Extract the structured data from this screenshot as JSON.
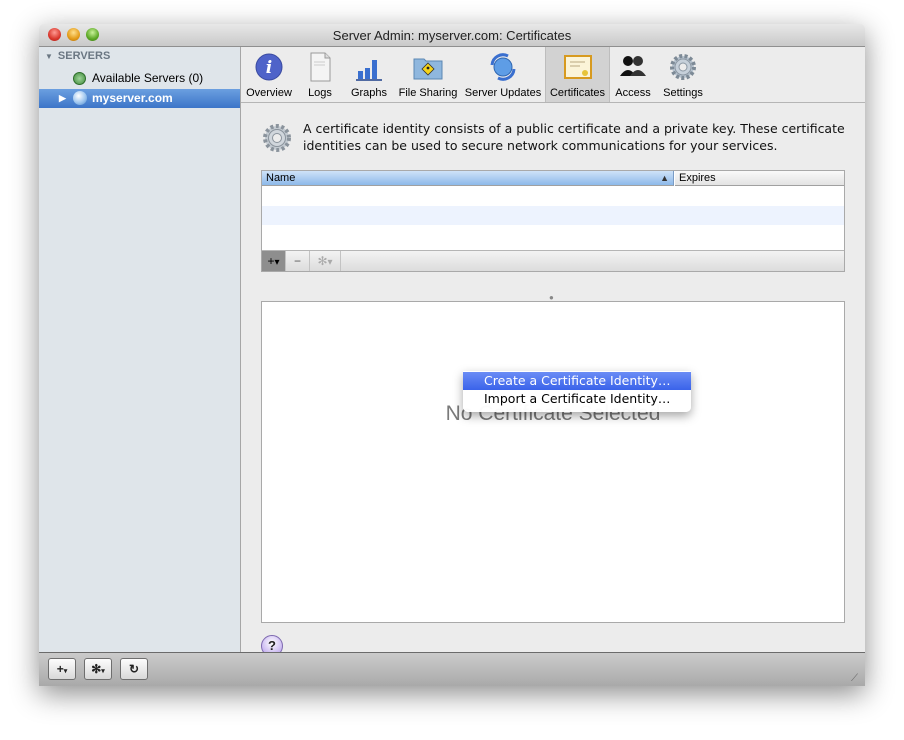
{
  "window": {
    "title": "Server Admin: myserver.com: Certificates"
  },
  "sidebar": {
    "group_label": "SERVERS",
    "items": [
      {
        "label": "Available Servers (0)",
        "icon": "network-globe-icon"
      },
      {
        "label": "myserver.com",
        "icon": "server-globe-icon",
        "selected": true
      }
    ]
  },
  "toolbar": {
    "items": [
      {
        "label": "Overview",
        "icon": "info-icon"
      },
      {
        "label": "Logs",
        "icon": "document-icon"
      },
      {
        "label": "Graphs",
        "icon": "bar-graph-icon"
      },
      {
        "label": "File Sharing",
        "icon": "shared-folder-icon"
      },
      {
        "label": "Server Updates",
        "icon": "software-update-icon"
      },
      {
        "label": "Certificates",
        "icon": "certificate-icon",
        "active": true
      },
      {
        "label": "Access",
        "icon": "users-icon"
      },
      {
        "label": "Settings",
        "icon": "gear-icon"
      }
    ]
  },
  "content": {
    "description": "A certificate identity consists of a public certificate and a private key. These certificate identities can be used to secure network communications for your services.",
    "table": {
      "columns": [
        "Name",
        "Expires"
      ],
      "sort_indicator": "▲",
      "rows": []
    },
    "table_toolbar": {
      "add": "+",
      "remove": "−",
      "action": "✻"
    },
    "add_menu": {
      "items": [
        {
          "label": "Create a Certificate Identity…",
          "highlighted": true
        },
        {
          "label": "Import a Certificate Identity…",
          "highlighted": false
        }
      ]
    },
    "detail_placeholder": "No Certificate Selected",
    "help_label": "?"
  },
  "statusbar": {
    "add": "+",
    "action": "✻",
    "refresh": "↻"
  },
  "colors": {
    "selection_blue": "#3c75c8",
    "menu_highlight": "#3a63ea",
    "sidebar_bg": "#dfe5ea"
  }
}
